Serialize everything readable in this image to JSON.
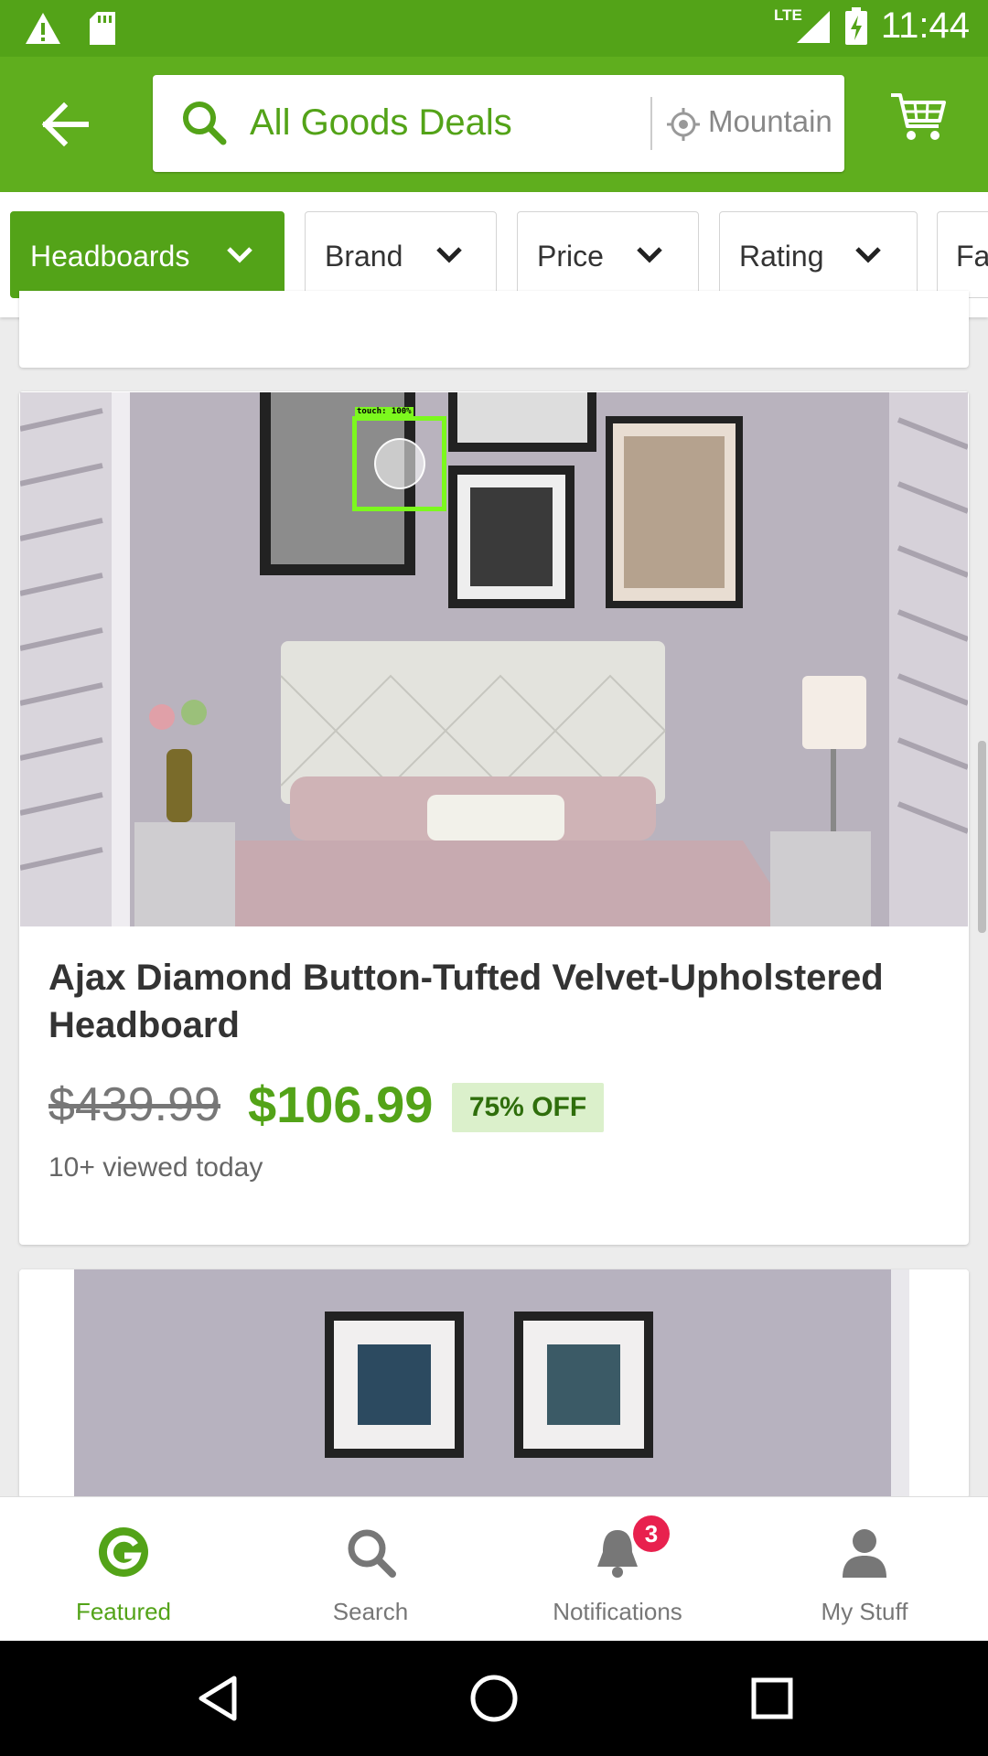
{
  "status_bar": {
    "time": "11:44",
    "network": "LTE",
    "icons": [
      "warning-icon",
      "sd-card-icon",
      "signal-icon",
      "battery-charging-icon"
    ]
  },
  "header": {
    "back_icon": "arrow-left-icon",
    "search_text": "All Goods Deals",
    "location_text": "Mountain",
    "cart_icon": "cart-icon"
  },
  "filters": [
    {
      "label": "Headboards",
      "active": true
    },
    {
      "label": "Brand",
      "active": false
    },
    {
      "label": "Price",
      "active": false
    },
    {
      "label": "Rating",
      "active": false
    },
    {
      "label": "Fa",
      "active": false
    }
  ],
  "overlay": {
    "touch_label": "touch: 100%"
  },
  "product": {
    "title": "Ajax Diamond Button-Tufted Velvet-Upholstered Headboard",
    "old_price": "$439.99",
    "new_price": "$106.99",
    "discount": "75% OFF",
    "views": "10+ viewed today"
  },
  "bottom_nav": [
    {
      "label": "Featured",
      "icon": "groupon-g-icon",
      "active": true
    },
    {
      "label": "Search",
      "icon": "search-icon",
      "active": false
    },
    {
      "label": "Notifications",
      "icon": "bell-icon",
      "active": false,
      "badge": "3"
    },
    {
      "label": "My Stuff",
      "icon": "person-icon",
      "active": false
    }
  ],
  "system_nav": [
    "back-triangle-icon",
    "home-circle-icon",
    "recents-square-icon"
  ],
  "colors": {
    "brand_green": "#53a318",
    "badge_red": "#e8214e",
    "discount_bg": "#dbf0cb"
  }
}
